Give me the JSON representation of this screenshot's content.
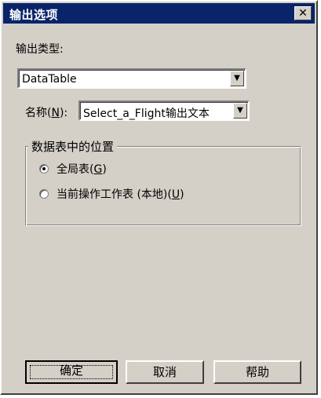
{
  "window": {
    "title": "输出选项",
    "close_glyph": "✕"
  },
  "output_type": {
    "label": "输出类型:",
    "selected": "DataTable"
  },
  "name": {
    "label_prefix": "名称(",
    "label_mnemonic": "N",
    "label_suffix": "):",
    "selected": "Select_a_Flight输出文本"
  },
  "location_group": {
    "title": "数据表中的位置",
    "options": [
      {
        "prefix": "全局表(",
        "mnemonic": "G",
        "suffix": ")",
        "selected": true
      },
      {
        "prefix": "当前操作工作表 (本地)(",
        "mnemonic": "U",
        "suffix": ")",
        "selected": false
      }
    ]
  },
  "buttons": {
    "ok": "确定",
    "cancel": "取消",
    "help": "帮助"
  }
}
